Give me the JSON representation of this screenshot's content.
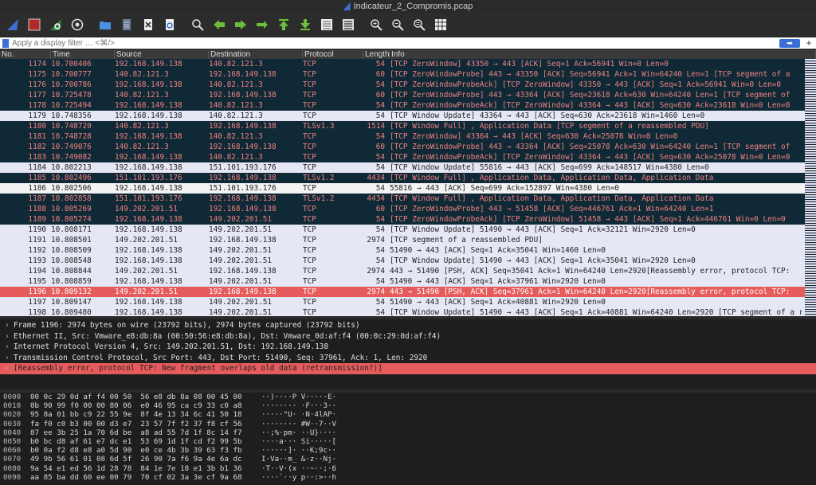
{
  "window": {
    "title": "Indicateur_2_Compromis.pcap"
  },
  "toolbar": {
    "buttons": [
      "shark-fin-icon",
      "stop-icon",
      "restart-icon",
      "options-gear-icon",
      "open-folder-icon",
      "file-icon",
      "close-file-icon",
      "reload-icon",
      "find-icon",
      "back-icon",
      "forward-icon",
      "goto-icon",
      "first-icon",
      "last-icon",
      "autoscroll-icon",
      "colorize-icon",
      "zoom-in-icon",
      "zoom-out-icon",
      "zoom-reset-icon",
      "resize-columns-icon"
    ]
  },
  "filter": {
    "placeholder": "Apply a display filter … <⌘/>",
    "apply_label": "➡"
  },
  "columns": {
    "no": "No.",
    "time": "Time",
    "source": "Source",
    "destination": "Destination",
    "protocol": "Protocol",
    "length": "Length",
    "info": "Info"
  },
  "packets": [
    {
      "no": "1174",
      "time": "10.700406",
      "src": "192.168.149.138",
      "dst": "140.82.121.3",
      "proto": "TCP",
      "len": "54",
      "info": "[TCP ZeroWindow] 43350 → 443 [ACK] Seq=1 Ack=56941 Win=0 Len=0",
      "style": "dark"
    },
    {
      "no": "1175",
      "time": "10.700777",
      "src": "140.82.121.3",
      "dst": "192.168.149.138",
      "proto": "TCP",
      "len": "60",
      "info": "[TCP ZeroWindowProbe] 443 → 43350 [ACK] Seq=56941 Ack=1 Win=64240 Len=1 [TCP segment of a",
      "style": "dark"
    },
    {
      "no": "1176",
      "time": "10.700786",
      "src": "192.168.149.138",
      "dst": "140.82.121.3",
      "proto": "TCP",
      "len": "54",
      "info": "[TCP ZeroWindowProbeAck] [TCP ZeroWindow] 43350 → 443 [ACK] Seq=1 Ack=56941 Win=0 Len=0",
      "style": "dark"
    },
    {
      "no": "1177",
      "time": "10.725478",
      "src": "140.82.121.3",
      "dst": "192.168.149.138",
      "proto": "TCP",
      "len": "60",
      "info": "[TCP ZeroWindowProbe] 443 → 43364 [ACK] Seq=23618 Ack=630 Win=64240 Len=1 [TCP segment of",
      "style": "dark"
    },
    {
      "no": "1178",
      "time": "10.725494",
      "src": "192.168.149.138",
      "dst": "140.82.121.3",
      "proto": "TCP",
      "len": "54",
      "info": "[TCP ZeroWindowProbeAck] [TCP ZeroWindow] 43364 → 443 [ACK] Seq=630 Ack=23618 Win=0 Len=0",
      "style": "dark"
    },
    {
      "no": "1179",
      "time": "10.748356",
      "src": "192.168.149.138",
      "dst": "140.82.121.3",
      "proto": "TCP",
      "len": "54",
      "info": "[TCP Window Update] 43364 → 443 [ACK] Seq=630 Ack=23618 Win=1460 Len=0",
      "style": "light"
    },
    {
      "no": "1180",
      "time": "10.748720",
      "src": "140.82.121.3",
      "dst": "192.168.149.138",
      "proto": "TLSv1.3",
      "len": "1514",
      "info": "[TCP Window Full] , Application Data [TCP segment of a reassembled PDU]",
      "style": "dark"
    },
    {
      "no": "1181",
      "time": "10.748728",
      "src": "192.168.149.138",
      "dst": "140.82.121.3",
      "proto": "TCP",
      "len": "54",
      "info": "[TCP ZeroWindow] 43364 → 443 [ACK] Seq=630 Ack=25078 Win=0 Len=0",
      "style": "dark"
    },
    {
      "no": "1182",
      "time": "10.749076",
      "src": "140.82.121.3",
      "dst": "192.168.149.138",
      "proto": "TCP",
      "len": "60",
      "info": "[TCP ZeroWindowProbe] 443 → 43364 [ACK] Seq=25078 Ack=630 Win=64240 Len=1 [TCP segment of",
      "style": "dark"
    },
    {
      "no": "1183",
      "time": "10.749082",
      "src": "192.168.149.138",
      "dst": "140.82.121.3",
      "proto": "TCP",
      "len": "54",
      "info": "[TCP ZeroWindowProbeAck] [TCP ZeroWindow] 43364 → 443 [ACK] Seq=630 Ack=25078 Win=0 Len=0",
      "style": "dark"
    },
    {
      "no": "1184",
      "time": "10.802213",
      "src": "192.168.149.138",
      "dst": "151.101.193.176",
      "proto": "TCP",
      "len": "54",
      "info": "[TCP Window Update] 55816 → 443 [ACK] Seq=699 Ack=148517 Win=4380 Len=0",
      "style": "light"
    },
    {
      "no": "1185",
      "time": "10.802496",
      "src": "151.101.193.176",
      "dst": "192.168.149.138",
      "proto": "TLSv1.2",
      "len": "4434",
      "info": "[TCP Window Full] , Application Data, Application Data, Application Data",
      "style": "dark"
    },
    {
      "no": "1186",
      "time": "10.802506",
      "src": "192.168.149.138",
      "dst": "151.101.193.176",
      "proto": "TCP",
      "len": "54",
      "info": "55816 → 443 [ACK] Seq=699 Ack=152897 Win=4380 Len=0",
      "style": "white"
    },
    {
      "no": "1187",
      "time": "10.802858",
      "src": "151.101.193.176",
      "dst": "192.168.149.138",
      "proto": "TLSv1.2",
      "len": "4434",
      "info": "[TCP Window Full] , Application Data, Application Data, Application Data",
      "style": "dark"
    },
    {
      "no": "1188",
      "time": "10.805269",
      "src": "149.202.201.51",
      "dst": "192.168.149.138",
      "proto": "TCP",
      "len": "60",
      "info": "[TCP ZeroWindowProbe] 443 → 51458 [ACK] Seq=446761 Ack=1 Win=64240 Len=1",
      "style": "dark"
    },
    {
      "no": "1189",
      "time": "10.805274",
      "src": "192.168.149.138",
      "dst": "149.202.201.51",
      "proto": "TCP",
      "len": "54",
      "info": "[TCP ZeroWindowProbeAck] [TCP ZeroWindow] 51458 → 443 [ACK] Seq=1 Ack=446761 Win=0 Len=0",
      "style": "dark"
    },
    {
      "no": "1190",
      "time": "10.808171",
      "src": "192.168.149.138",
      "dst": "149.202.201.51",
      "proto": "TCP",
      "len": "54",
      "info": "[TCP Window Update] 51490 → 443 [ACK] Seq=1 Ack=32121 Win=2920 Len=0",
      "style": "light"
    },
    {
      "no": "1191",
      "time": "10.808501",
      "src": "149.202.201.51",
      "dst": "192.168.149.138",
      "proto": "TCP",
      "len": "2974",
      "info": "[TCP segment of a reassembled PDU]",
      "style": "light"
    },
    {
      "no": "1192",
      "time": "10.808509",
      "src": "192.168.149.138",
      "dst": "149.202.201.51",
      "proto": "TCP",
      "len": "54",
      "info": "51490 → 443 [ACK] Seq=1 Ack=35041 Win=1460 Len=0",
      "style": "light"
    },
    {
      "no": "1193",
      "time": "10.808548",
      "src": "192.168.149.138",
      "dst": "149.202.201.51",
      "proto": "TCP",
      "len": "54",
      "info": "[TCP Window Update] 51490 → 443 [ACK] Seq=1 Ack=35041 Win=2920 Len=0",
      "style": "light"
    },
    {
      "no": "1194",
      "time": "10.808844",
      "src": "149.202.201.51",
      "dst": "192.168.149.138",
      "proto": "TCP",
      "len": "2974",
      "info": "443 → 51490 [PSH, ACK] Seq=35041 Ack=1 Win=64240 Len=2920[Reassembly error, protocol TCP:",
      "style": "light"
    },
    {
      "no": "1195",
      "time": "10.808859",
      "src": "192.168.149.138",
      "dst": "149.202.201.51",
      "proto": "TCP",
      "len": "54",
      "info": "51490 → 443 [ACK] Seq=1 Ack=37961 Win=2920 Len=0",
      "style": "light"
    },
    {
      "no": "1196",
      "time": "10.809132",
      "src": "149.202.201.51",
      "dst": "192.168.149.138",
      "proto": "TCP",
      "len": "2974",
      "info": "443 → 51490 [PSH, ACK] Seq=37961 Ack=1 Win=64240 Len=2920[Reassembly error, protocol TCP:",
      "style": "sel"
    },
    {
      "no": "1197",
      "time": "10.809147",
      "src": "192.168.149.138",
      "dst": "149.202.201.51",
      "proto": "TCP",
      "len": "54",
      "info": "51490 → 443 [ACK] Seq=1 Ack=40881 Win=2920 Len=0",
      "style": "light"
    },
    {
      "no": "1198",
      "time": "10.809480",
      "src": "192.168.149.138",
      "dst": "149.202.201.51",
      "proto": "TCP",
      "len": "54",
      "info": "[TCP Window Update] 51490 → 443 [ACK] Seq=1 Ack=40881 Win=64240 Len=2920 [TCP segment of a reassembled PDU]",
      "style": "light"
    }
  ],
  "details": [
    {
      "text": "Frame 1196: 2974 bytes on wire (23792 bits), 2974 bytes captured (23792 bits)",
      "style": "normal"
    },
    {
      "text": "Ethernet II, Src: Vmware_e8:db:8a (00:50:56:e8:db:8a), Dst: Vmware_0d:af:f4 (00:0c:29:0d:af:f4)",
      "style": "normal"
    },
    {
      "text": "Internet Protocol Version 4, Src: 149.202.201.51, Dst: 192.168.149.138",
      "style": "normal"
    },
    {
      "text": "Transmission Control Protocol, Src Port: 443, Dst Port: 51490, Seq: 37961, Ack: 1, Len: 2920",
      "style": "normal"
    },
    {
      "text": "[Reassembly error, protocol TCP: New fragment overlaps old data (retransmission?)]",
      "style": "err"
    }
  ],
  "hex": [
    {
      "off": "0000",
      "bytes": "00 0c 29 0d af f4 00 50  56 e8 db 8a 08 00 45 00",
      "ascii": "··)····P V·····E·"
    },
    {
      "off": "0010",
      "bytes": "0b 90 99 f0 00 00 80 06  e0 46 95 ca c9 33 c0 a8",
      "ascii": "········ ·F···3··"
    },
    {
      "off": "0020",
      "bytes": "95 8a 01 bb c9 22 55 9e  8f 4e 13 34 6c 41 50 18",
      "ascii": "·····\"U· ·N·4lAP·"
    },
    {
      "off": "0030",
      "bytes": "fa f0 c0 b3 00 00 d3 e7  23 57 7f f2 37 f8 cf 56",
      "ascii": "········ #W··7··V"
    },
    {
      "off": "0040",
      "bytes": "87 ee 3b 25 1a 70 6d be  a8 ad 55 7d 1f 8c 14 f7",
      "ascii": "··;%·pm· ··U}····"
    },
    {
      "off": "0050",
      "bytes": "b0 bc d8 af 61 e7 dc e1  53 69 1d 1f cd f2 99 5b",
      "ascii": "····a··· Si·····["
    },
    {
      "off": "0060",
      "bytes": "b0 0a f2 d8 e8 a0 5d 90  e0 ce 4b 3b 39 63 f3 fb",
      "ascii": "······]· ··K;9c··"
    },
    {
      "off": "0070",
      "bytes": "49 9b 56 61 01 08 6d 5f  26 90 7a f6 9a 4e 6a dc",
      "ascii": "I·Va··m_ &·z··Nj·"
    },
    {
      "off": "0080",
      "bytes": "9a 54 e1 ed 56 1d 28 78  84 1e 7e 18 e1 3b b1 36",
      "ascii": "·T··V·(x ··~··;·6"
    },
    {
      "off": "0090",
      "bytes": "aa 85 ba dd 60 ee 00 79  70 cf 02 3a 3e cf 9a 68",
      "ascii": "····`··y p··:>··h"
    }
  ]
}
